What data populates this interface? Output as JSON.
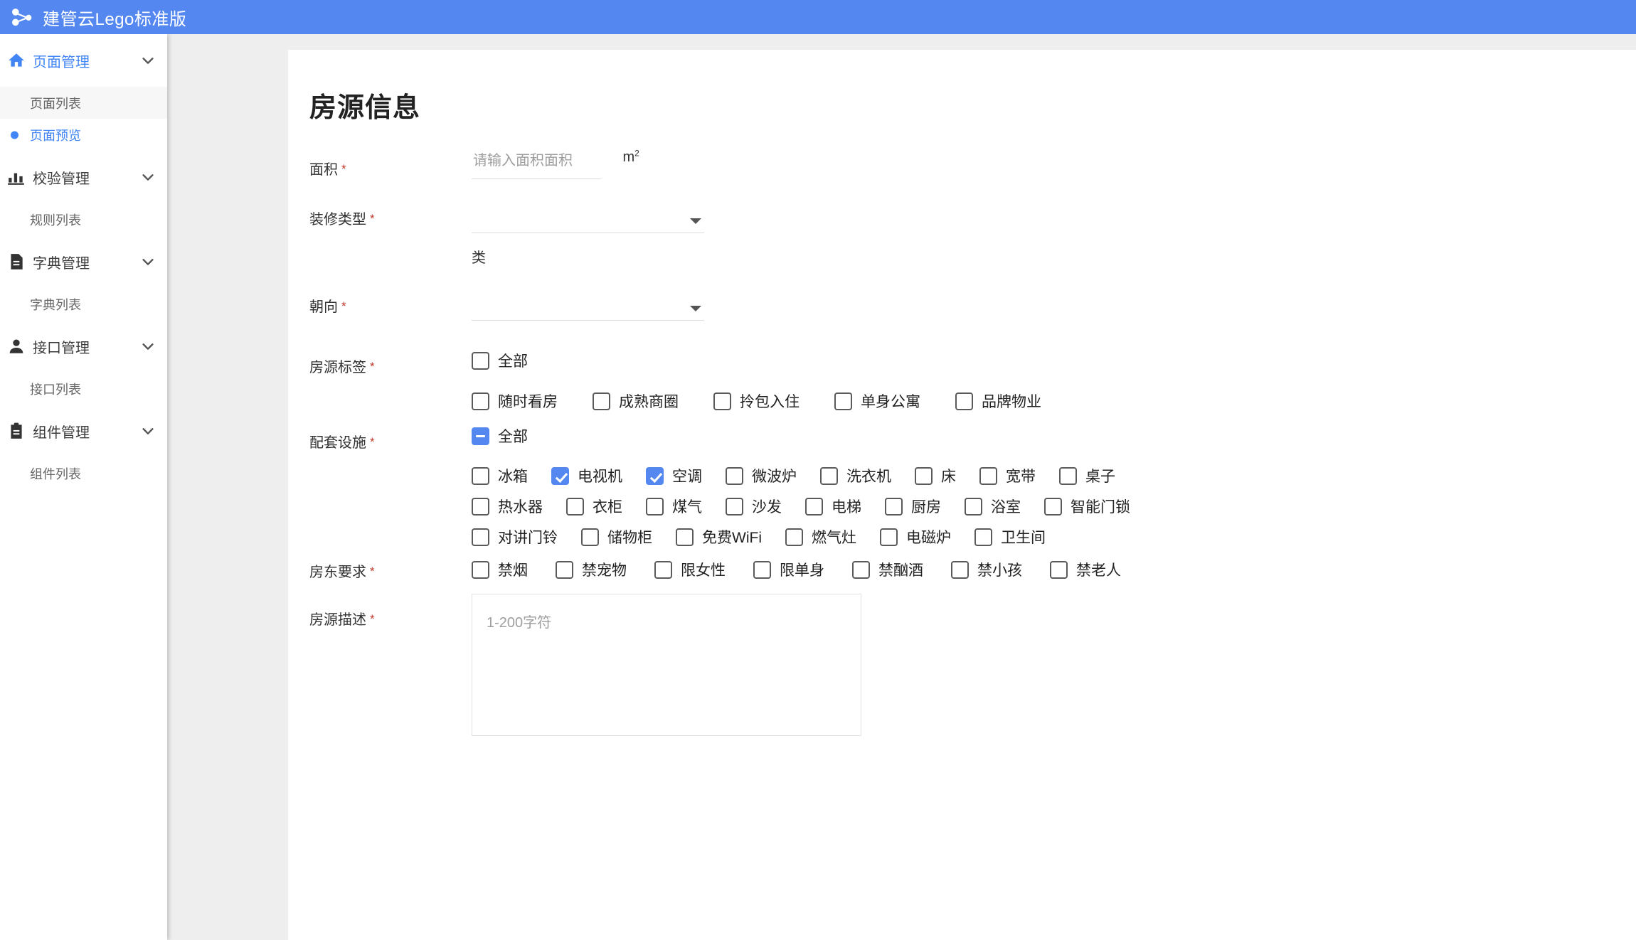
{
  "header": {
    "app_title": "建管云Lego标准版",
    "logo_icon": "share-nodes-icon",
    "background_color": "#5488f0"
  },
  "sidebar": {
    "groups": [
      {
        "label": "页面管理",
        "icon": "home-icon",
        "active": true,
        "chevron": "chevron-down-icon",
        "children": [
          {
            "label": "页面列表",
            "state": "hover"
          },
          {
            "label": "页面预览",
            "state": "selected"
          }
        ]
      },
      {
        "label": "校验管理",
        "icon": "bar-chart-icon",
        "active": false,
        "chevron": "chevron-down-icon",
        "children": [
          {
            "label": "规则列表",
            "state": "normal"
          }
        ]
      },
      {
        "label": "字典管理",
        "icon": "document-icon",
        "active": false,
        "chevron": "chevron-down-icon",
        "children": [
          {
            "label": "字典列表",
            "state": "normal"
          }
        ]
      },
      {
        "label": "接口管理",
        "icon": "user-icon",
        "active": false,
        "chevron": "chevron-down-icon",
        "children": [
          {
            "label": "接口列表",
            "state": "normal"
          }
        ]
      },
      {
        "label": "组件管理",
        "icon": "clipboard-icon",
        "active": false,
        "chevron": "chevron-down-icon",
        "children": [
          {
            "label": "组件列表",
            "state": "normal"
          }
        ]
      }
    ]
  },
  "form": {
    "title": "房源信息",
    "required_marker": "*",
    "area": {
      "label": "面积",
      "placeholder": "请输入面积面积",
      "value": "",
      "unit": "m",
      "unit_sup": "2"
    },
    "decoration": {
      "label": "装修类型",
      "value": "",
      "sub_label": "类",
      "caret_icon": "chevron-down-icon"
    },
    "orientation": {
      "label": "朝向",
      "value": "",
      "caret_icon": "chevron-down-icon"
    },
    "house_tags": {
      "label": "房源标签",
      "all_label": "全部",
      "all_state": "unchecked",
      "options": [
        {
          "label": "随时看房",
          "checked": false
        },
        {
          "label": "成熟商圈",
          "checked": false
        },
        {
          "label": "拎包入住",
          "checked": false
        },
        {
          "label": "单身公寓",
          "checked": false
        },
        {
          "label": "品牌物业",
          "checked": false
        }
      ]
    },
    "facilities": {
      "label": "配套设施",
      "all_label": "全部",
      "all_state": "indeterminate",
      "rows": [
        [
          {
            "label": "冰箱",
            "checked": false
          },
          {
            "label": "电视机",
            "checked": true
          },
          {
            "label": "空调",
            "checked": true
          },
          {
            "label": "微波炉",
            "checked": false
          },
          {
            "label": "洗衣机",
            "checked": false
          },
          {
            "label": "床",
            "checked": false
          },
          {
            "label": "宽带",
            "checked": false
          },
          {
            "label": "桌子",
            "checked": false
          }
        ],
        [
          {
            "label": "热水器",
            "checked": false
          },
          {
            "label": "衣柜",
            "checked": false
          },
          {
            "label": "煤气",
            "checked": false
          },
          {
            "label": "沙发",
            "checked": false
          },
          {
            "label": "电梯",
            "checked": false
          },
          {
            "label": "厨房",
            "checked": false
          },
          {
            "label": "浴室",
            "checked": false
          },
          {
            "label": "智能门锁",
            "checked": false
          }
        ],
        [
          {
            "label": "对讲门铃",
            "checked": false
          },
          {
            "label": "储物柜",
            "checked": false
          },
          {
            "label": "免费WiFi",
            "checked": false
          },
          {
            "label": "燃气灶",
            "checked": false
          },
          {
            "label": "电磁炉",
            "checked": false
          },
          {
            "label": "卫生间",
            "checked": false
          }
        ]
      ]
    },
    "landlord_requirements": {
      "label": "房东要求",
      "options": [
        {
          "label": "禁烟",
          "checked": false
        },
        {
          "label": "禁宠物",
          "checked": false
        },
        {
          "label": "限女性",
          "checked": false
        },
        {
          "label": "限单身",
          "checked": false
        },
        {
          "label": "禁酗酒",
          "checked": false
        },
        {
          "label": "禁小孩",
          "checked": false
        },
        {
          "label": "禁老人",
          "checked": false
        }
      ]
    },
    "description": {
      "label": "房源描述",
      "placeholder": "1-200字符",
      "value": ""
    }
  },
  "colors": {
    "brand_blue": "#5488f0",
    "link_blue": "#4285f4",
    "required_red": "#c0392b",
    "canvas_gray": "#eeeeee"
  }
}
